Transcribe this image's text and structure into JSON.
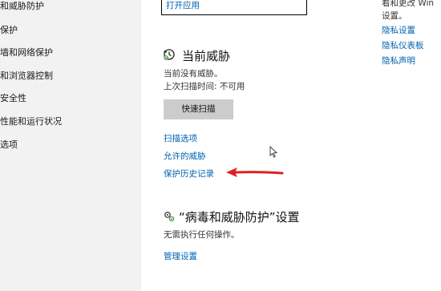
{
  "sidebar": {
    "items": [
      {
        "label": "和威胁防护"
      },
      {
        "label": "保护"
      },
      {
        "label": "墙和网络保护"
      },
      {
        "label": "和浏览器控制"
      },
      {
        "label": "安全性"
      },
      {
        "label": "性能和运行状况"
      },
      {
        "label": "选项"
      }
    ]
  },
  "main": {
    "open_app_link": "打开应用",
    "threats": {
      "title": "当前威胁",
      "status": "当前没有威胁。",
      "last_scan": "上次扫描时间: 不可用",
      "quick_scan_button": "快速扫描",
      "links": [
        "扫描选项",
        "允许的威胁",
        "保护历史记录"
      ]
    },
    "settings": {
      "title": "“病毒和威胁防护”设置",
      "status": "无需执行任何操作。",
      "manage_link": "管理设置"
    }
  },
  "right_panel": {
    "line1": "看和更改 Win",
    "line2": "设置。",
    "links": [
      "隐私设置",
      "隐私仪表板",
      "隐私声明"
    ]
  },
  "colors": {
    "link": "#0063b1",
    "sidebar_bg": "#f2f2f2",
    "button_bg": "#cccccc",
    "annotation_arrow": "#e02020"
  }
}
